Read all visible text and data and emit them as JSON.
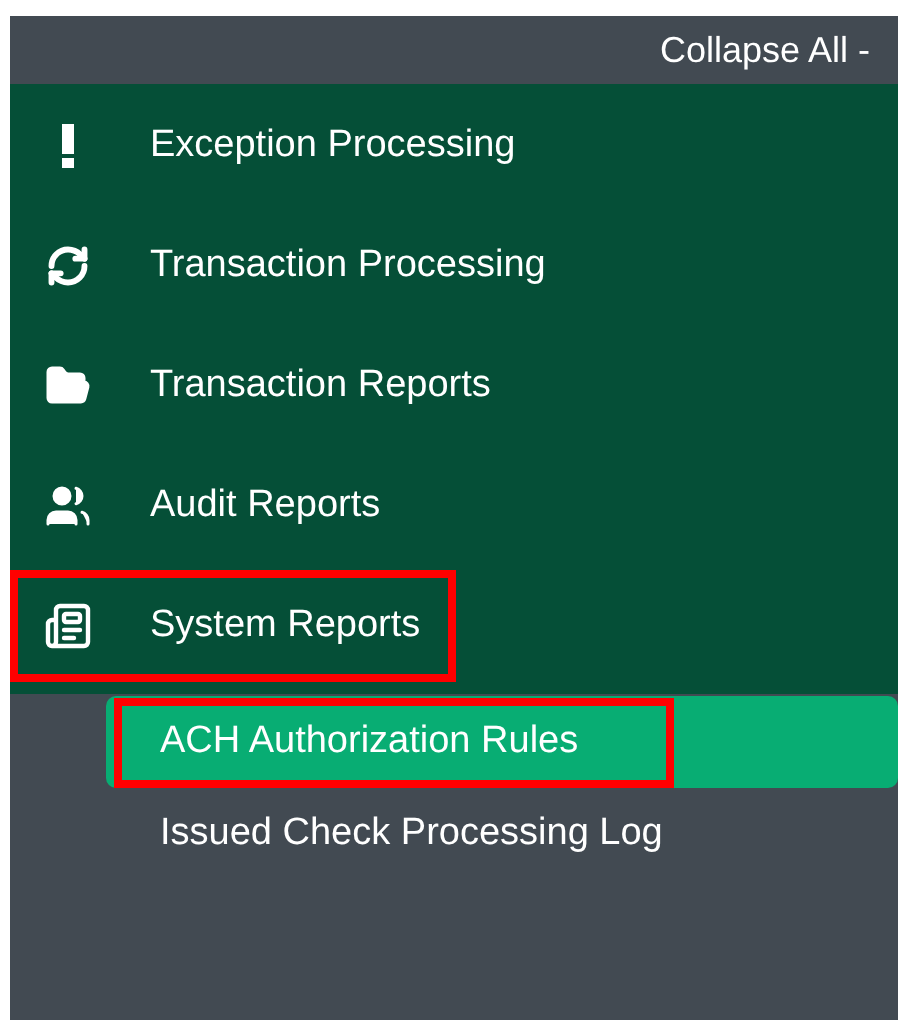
{
  "header": {
    "collapse_label": "Collapse All -"
  },
  "menu": [
    {
      "kind": "exclamation",
      "label": "Exception Processing",
      "highlighted": false
    },
    {
      "kind": "refresh",
      "label": "Transaction Processing",
      "highlighted": false
    },
    {
      "kind": "folder",
      "label": "Transaction Reports",
      "highlighted": false
    },
    {
      "kind": "users",
      "label": "Audit Reports",
      "highlighted": false
    },
    {
      "kind": "newspaper",
      "label": "System Reports",
      "highlighted": true
    }
  ],
  "submenu": [
    {
      "label": "ACH Authorization Rules",
      "selected": true,
      "highlighted": true
    },
    {
      "label": "Issued Check Processing Log",
      "selected": false,
      "highlighted": false
    }
  ]
}
